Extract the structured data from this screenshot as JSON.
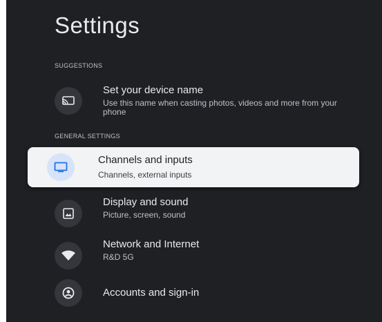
{
  "header": {
    "title": "Settings"
  },
  "sections": {
    "suggestions": "SUGGESTIONS",
    "general": "GENERAL SETTINGS"
  },
  "items": {
    "device_name": {
      "title": "Set your device name",
      "subtitle": "Use this name when casting photos, videos and more from your phone",
      "icon": "cast-icon"
    },
    "channels": {
      "title": "Channels and inputs",
      "subtitle": "Channels, external inputs",
      "icon": "tv-icon",
      "focused": true
    },
    "display": {
      "title": "Display and sound",
      "subtitle": "Picture, screen, sound",
      "icon": "image-icon"
    },
    "network": {
      "title": "Network and Internet",
      "subtitle": "R&D 5G",
      "icon": "wifi-icon"
    },
    "accounts": {
      "title": "Accounts and sign-in",
      "icon": "account-icon"
    }
  },
  "colors": {
    "background": "#1f2024",
    "focus_card": "#f1f3f4",
    "focus_icon_bg": "#d7e3f8",
    "focus_icon": "#1a73e8",
    "icon_bg": "#34363b"
  }
}
